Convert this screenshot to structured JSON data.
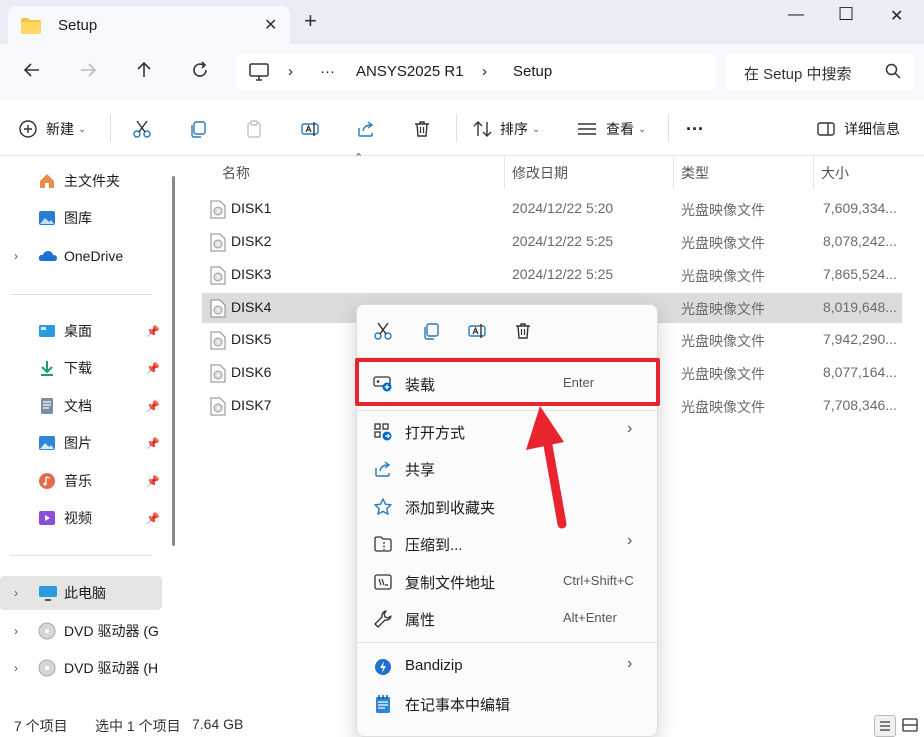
{
  "window": {
    "tab_title": "Setup",
    "tab_close": "✕",
    "new_tab": "+",
    "minimize": "—",
    "maximize": "☐",
    "close": "✕"
  },
  "address": {
    "more": "···",
    "segments": [
      "ANSYS2025 R1",
      "Setup"
    ],
    "separator": "›",
    "search_placeholder": "在 Setup 中搜索"
  },
  "toolbar": {
    "new_label": "新建",
    "sort_label": "排序",
    "view_label": "查看",
    "more_label": "···",
    "details_label": "详细信息"
  },
  "sidebar": {
    "items": [
      {
        "label": "主文件夹",
        "icon": "home-icon"
      },
      {
        "label": "图库",
        "icon": "gallery-icon"
      },
      {
        "label": "OneDrive",
        "icon": "onedrive-icon",
        "expandable": true
      },
      {
        "label": "桌面",
        "icon": "desktop-icon",
        "pinned": true
      },
      {
        "label": "下载",
        "icon": "download-icon",
        "pinned": true
      },
      {
        "label": "文档",
        "icon": "documents-icon",
        "pinned": true
      },
      {
        "label": "图片",
        "icon": "pictures-icon",
        "pinned": true
      },
      {
        "label": "音乐",
        "icon": "music-icon",
        "pinned": true
      },
      {
        "label": "视频",
        "icon": "videos-icon",
        "pinned": true
      },
      {
        "label": "此电脑",
        "icon": "this-pc-icon",
        "expandable": true,
        "selected": true
      },
      {
        "label": "DVD 驱动器 (G",
        "icon": "dvd-icon",
        "expandable": true
      },
      {
        "label": "DVD 驱动器 (H",
        "icon": "dvd-icon",
        "expandable": true
      }
    ]
  },
  "filelist": {
    "columns": {
      "name": "名称",
      "date": "修改日期",
      "type": "类型",
      "size": "大小"
    },
    "rows": [
      {
        "name": "DISK1",
        "date": "2024/12/22 5:20",
        "type": "光盘映像文件",
        "size": "7,609,334..."
      },
      {
        "name": "DISK2",
        "date": "2024/12/22 5:25",
        "type": "光盘映像文件",
        "size": "8,078,242..."
      },
      {
        "name": "DISK3",
        "date": "2024/12/22 5:25",
        "type": "光盘映像文件",
        "size": "7,865,524..."
      },
      {
        "name": "DISK4",
        "date": "",
        "type": "光盘映像文件",
        "size": "8,019,648...",
        "selected": true
      },
      {
        "name": "DISK5",
        "date": "",
        "type": "光盘映像文件",
        "size": "7,942,290..."
      },
      {
        "name": "DISK6",
        "date": "",
        "type": "光盘映像文件",
        "size": "8,077,164..."
      },
      {
        "name": "DISK7",
        "date": "",
        "type": "光盘映像文件",
        "size": "7,708,346..."
      }
    ]
  },
  "status": {
    "count": "7 个项目",
    "selected": "选中 1 个项目",
    "size": "7.64 GB"
  },
  "context_menu": {
    "items": [
      {
        "label": "装载",
        "shortcut": "Enter",
        "icon": "mount-icon",
        "highlighted": true
      },
      {
        "label": "打开方式",
        "submenu": true,
        "icon": "open-with-icon"
      },
      {
        "label": "共享",
        "icon": "share-icon"
      },
      {
        "label": "添加到收藏夹",
        "icon": "star-icon"
      },
      {
        "label": "压缩到...",
        "submenu": true,
        "icon": "zip-icon"
      },
      {
        "label": "复制文件地址",
        "shortcut": "Ctrl+Shift+C",
        "icon": "copy-path-icon"
      },
      {
        "label": "属性",
        "shortcut": "Alt+Enter",
        "icon": "wrench-icon"
      },
      {
        "label": "Bandizip",
        "submenu": true,
        "icon": "bandizip-icon"
      },
      {
        "label": "在记事本中编辑",
        "icon": "notepad-icon"
      }
    ],
    "submenu_arrow": "›"
  },
  "colors": {
    "highlight_box": "#e8252f",
    "arrow": "#e8252f",
    "accent": "#0067c0"
  }
}
